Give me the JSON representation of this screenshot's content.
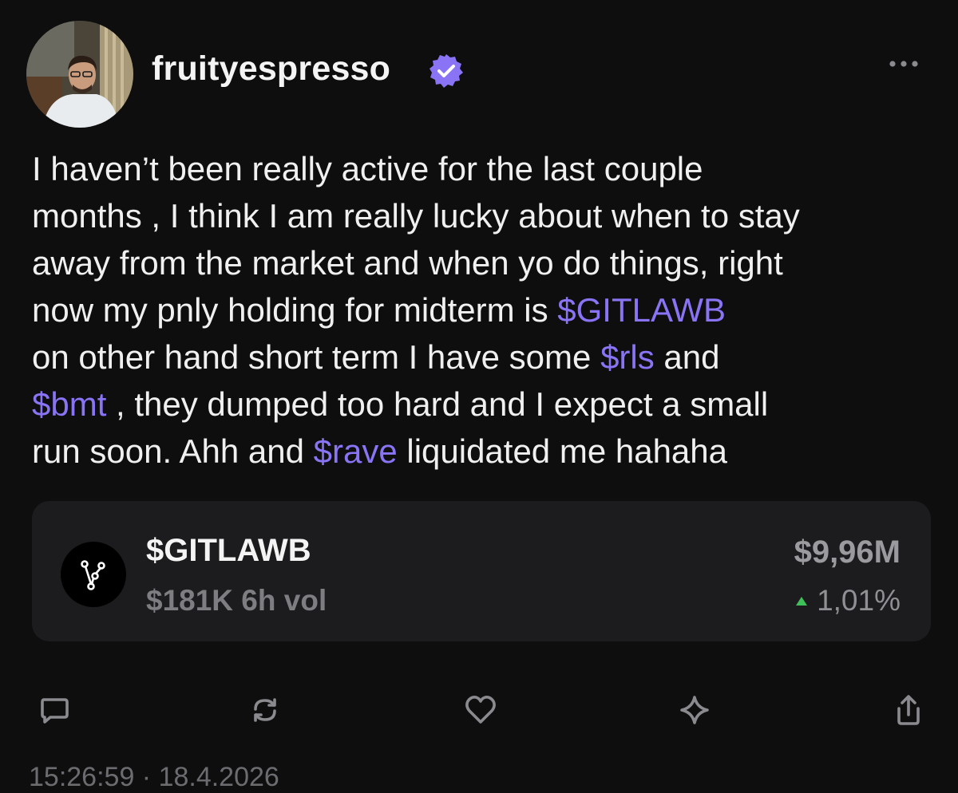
{
  "post": {
    "username": "fruityespresso",
    "verified": true,
    "body_lines": [
      [
        {
          "text": "I haven’t been really active for the last couple",
          "type": "text"
        }
      ],
      [
        {
          "text": "months , I think I am really lucky about when to stay",
          "type": "text"
        }
      ],
      [
        {
          "text": "away from the market and when yo do things, right",
          "type": "text"
        }
      ],
      [
        {
          "text": "now my pnly holding for midterm is ",
          "type": "text"
        },
        {
          "text": "$GITLAWB",
          "type": "cashtag"
        }
      ],
      [
        {
          "text": "on other hand short term I have some ",
          "type": "text"
        },
        {
          "text": "$rls",
          "type": "cashtag"
        },
        {
          "text": " and",
          "type": "text"
        }
      ],
      [
        {
          "text": "$bmt",
          "type": "cashtag"
        },
        {
          "text": " , they dumped too hard and I expect a small",
          "type": "text"
        }
      ],
      [
        {
          "text": "run soon. Ahh and ",
          "type": "text"
        },
        {
          "text": "$rave",
          "type": "cashtag"
        },
        {
          "text": " liquidated me hahaha",
          "type": "text"
        }
      ]
    ],
    "timestamp": "15:26:59 · 18.4.2026"
  },
  "token_card": {
    "name": "$GITLAWB",
    "volume": "$181K 6h vol",
    "market_cap": "$9,96M",
    "change": "1,01%",
    "change_direction": "up",
    "change_color": "#3fc15a"
  },
  "actions": [
    {
      "name": "reply",
      "icon": "reply-icon"
    },
    {
      "name": "repost",
      "icon": "repost-icon"
    },
    {
      "name": "like",
      "icon": "heart-icon"
    },
    {
      "name": "boost",
      "icon": "sparkle-icon"
    },
    {
      "name": "share",
      "icon": "share-icon"
    }
  ],
  "colors": {
    "background": "#0e0e0f",
    "accent": "#8a74f5",
    "card": "#1c1c1e"
  }
}
